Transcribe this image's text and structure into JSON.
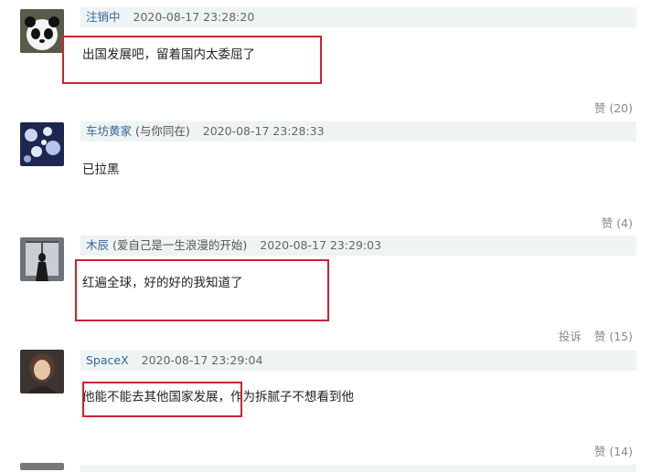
{
  "comments": [
    {
      "username": "注销中",
      "signature": "",
      "timestamp": "2020-08-17 23:28:20",
      "text": "出国发展吧，留着国内太委屈了",
      "like_label": "赞",
      "like_count": "(20)"
    },
    {
      "username": "车坊黄家",
      "signature": "(与你同在)",
      "timestamp": "2020-08-17 23:28:33",
      "text": "已拉黑",
      "like_label": "赞",
      "like_count": "(4)"
    },
    {
      "username": "木辰",
      "signature": "(爱自己是一生浪漫的开始)",
      "timestamp": "2020-08-17 23:29:03",
      "text": "红遍全球，好的好的我知道了",
      "report_label": "投诉",
      "like_label": "赞",
      "like_count": "(15)"
    },
    {
      "username": "SpaceX",
      "signature": "",
      "timestamp": "2020-08-17 23:29:04",
      "text": "他能不能去其他国家发展，作为拆腻子不想看到他",
      "like_label": "赞",
      "like_count": "(14)"
    }
  ],
  "colors": {
    "highlight_box": "#cc2233",
    "meta_background": "#eef3f3",
    "username": "#336699"
  }
}
